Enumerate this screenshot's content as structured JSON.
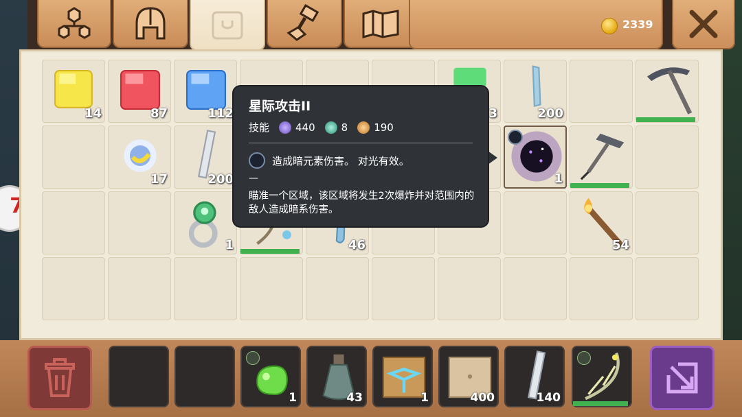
{
  "top_bar": {
    "tabs": [
      {
        "name": "tab-structure",
        "icon": "hierarchy-icon",
        "active": false
      },
      {
        "name": "tab-equipment",
        "icon": "helmet-icon",
        "active": false
      },
      {
        "name": "tab-inventory",
        "icon": "bag-icon",
        "active": true
      },
      {
        "name": "tab-crafting",
        "icon": "hammer-icon",
        "active": false
      },
      {
        "name": "tab-map",
        "icon": "map-icon",
        "active": false
      }
    ],
    "gold": "2339",
    "close_icon": "close-icon"
  },
  "side_badge": {
    "text": "7"
  },
  "inventory": {
    "slots": [
      {
        "row": 0,
        "col": 0,
        "item": "yellow-gem-cube",
        "count": "14"
      },
      {
        "row": 0,
        "col": 1,
        "item": "red-gem-cube",
        "count": "87"
      },
      {
        "row": 0,
        "col": 2,
        "item": "blue-gem-cube",
        "count": "112"
      },
      {
        "row": 0,
        "col": 6,
        "item": "green-gem",
        "count": "3"
      },
      {
        "row": 0,
        "col": 7,
        "item": "crystal-shard",
        "count": "200"
      },
      {
        "row": 0,
        "col": 9,
        "item": "pickaxe",
        "count": "",
        "durability": 0.95
      },
      {
        "row": 1,
        "col": 1,
        "item": "prism-orb",
        "count": "17"
      },
      {
        "row": 1,
        "col": 2,
        "item": "stone-slab",
        "count": "200"
      },
      {
        "row": 1,
        "col": 7,
        "item": "dark-orb",
        "count": "1",
        "selected": true
      },
      {
        "row": 1,
        "col": 8,
        "item": "spike-hammer",
        "count": "",
        "durability": 0.95
      },
      {
        "row": 2,
        "col": 2,
        "item": "emerald-ring",
        "count": "1"
      },
      {
        "row": 2,
        "col": 3,
        "item": "bow-frame",
        "count": "",
        "durability": 0.95
      },
      {
        "row": 2,
        "col": 4,
        "item": "ice-shard",
        "count": "46"
      },
      {
        "row": 2,
        "col": 8,
        "item": "torch",
        "count": "54"
      }
    ]
  },
  "tooltip": {
    "title": "星际攻击II",
    "type_label": "技能",
    "stats": [
      {
        "icon": "purple-mana-icon",
        "value": "440",
        "color": "#8e6fd8"
      },
      {
        "icon": "green-energy-icon",
        "value": "8",
        "color": "#3fb59a"
      },
      {
        "icon": "orange-sword-icon",
        "value": "190",
        "color": "#e19a3a"
      }
    ],
    "effect_text": "造成暗元素伤害。 对光有效。",
    "dash": "—",
    "description": "瞄准一个区域，该区域将发生2次爆炸并对范围内的敌人造成暗系伤害。"
  },
  "hotbar": {
    "trash_icon": "trash-icon",
    "drop_icon": "drop-icon",
    "slots": [
      {
        "item": "",
        "count": ""
      },
      {
        "item": "",
        "count": ""
      },
      {
        "item": "green-slime",
        "count": "1",
        "badge": true
      },
      {
        "item": "potion-flask",
        "count": "43"
      },
      {
        "item": "rune-cube",
        "count": "1"
      },
      {
        "item": "stone-block",
        "count": "400"
      },
      {
        "item": "stone-slab",
        "count": "140"
      },
      {
        "item": "thorn-bow",
        "count": "",
        "badge": true,
        "durability": 0.95
      }
    ]
  }
}
